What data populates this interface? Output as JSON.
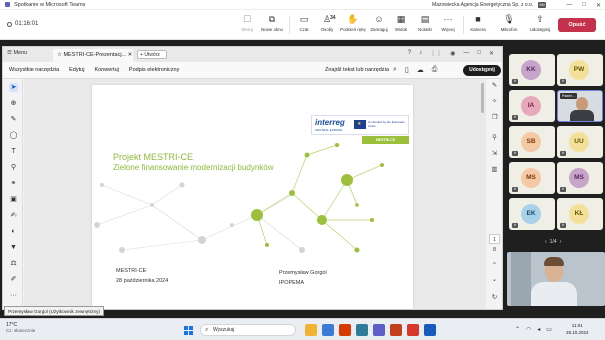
{
  "teams": {
    "window_title": "Spotkanie w Microsoft Teams",
    "org_label": "Mazowiecka Agencja Energetyczna Sp. z o.o.",
    "user_initials": "BM",
    "window_controls": [
      "—",
      "□",
      "✕"
    ],
    "timer": "01:16:01",
    "toolbar": [
      {
        "label": "Steruj",
        "icon": "pointer-icon",
        "dim": true
      },
      {
        "label": "Nowe okno",
        "icon": "new-window-icon",
        "dim": false
      },
      {
        "label": "Czat",
        "icon": "chat-icon",
        "dim": false
      },
      {
        "label": "Osoby",
        "icon": "people-icon",
        "dim": false,
        "count": "34"
      },
      {
        "label": "Podnieś rękę",
        "icon": "raise-hand-icon",
        "dim": false
      },
      {
        "label": "Zareaguj",
        "icon": "react-icon",
        "dim": false
      },
      {
        "label": "Widok",
        "icon": "view-icon",
        "dim": false
      },
      {
        "label": "Notatki",
        "icon": "notes-icon",
        "dim": false
      },
      {
        "label": "Więcej",
        "icon": "more-icon",
        "dim": false
      },
      {
        "label": "Kamera",
        "icon": "camera-icon",
        "dim": false
      },
      {
        "label": "Mikrofon",
        "icon": "mic-icon",
        "dim": false
      },
      {
        "label": "Udostępnij",
        "icon": "share-icon",
        "dim": false
      }
    ],
    "leave_label": "Opuść"
  },
  "viewer": {
    "menu_label": "Menu",
    "tab_label": "MESTRI-CE-Prezentacj...",
    "new_tab_label": "Utwórz",
    "menu_items": [
      "Wszystkie narzędzia",
      "Edytuj",
      "Konwertuj",
      "Podpis elektroniczny"
    ],
    "find_label": "Znajdź tekst lub narzędzia",
    "share_label": "Udostępnij",
    "page_current": "1",
    "page_total": "8",
    "tooltip": "Przemysław Gorgol (Użytkownik zewnętrzny)"
  },
  "slide": {
    "logo_text": "interreg",
    "logo_sub": "CENTRAL EUROPE",
    "cofund_text": "Co-funded by the European Union",
    "project_tag": "MESTRI-CE",
    "headline1": "Projekt MESTRI-CE",
    "headline2": "Zielone finansowanie modernizacji budynków",
    "meta_left1": "MESTRI-CE",
    "meta_left2": "28 października 2024",
    "meta_right1": "Przemysław Gorgol",
    "meta_right2": "IPOPEMA"
  },
  "participants": {
    "tiles": [
      {
        "initials": "KK",
        "color": "#c7a4c9",
        "text": "#5b2a60"
      },
      {
        "initials": "PW",
        "color": "#f3e09a",
        "text": "#6a5200"
      },
      {
        "initials": "IA",
        "color": "#e7a9b9",
        "text": "#7a1f3d"
      },
      {
        "initials": "SB",
        "color": "#f6c9a6",
        "text": "#7a3a0a"
      },
      {
        "initials": "UU",
        "color": "#f3e09a",
        "text": "#6a5200"
      },
      {
        "initials": "MS",
        "color": "#f6c9a6",
        "text": "#7a3a0a"
      },
      {
        "initials": "MS",
        "color": "#c7a4c9",
        "text": "#5b2a60"
      },
      {
        "initials": "EK",
        "color": "#a9d1e8",
        "text": "#0d4a6b"
      },
      {
        "initials": "KŁ",
        "color": "#f3e09a",
        "text": "#6a5200"
      }
    ],
    "video_name": "Paweł ...",
    "pager": "1/4"
  },
  "taskbar": {
    "temp": "17°C",
    "weather": "Cz. słonecznie",
    "search_placeholder": "Wyszukaj",
    "time": "11:01",
    "date": "28.10.2024",
    "app_colors": [
      "#f2b233",
      "#3a7bd5",
      "#d83b01",
      "#2d7d9a",
      "#5b5fc7",
      "#c43e1c",
      "#d9372b",
      "#185abd"
    ]
  }
}
